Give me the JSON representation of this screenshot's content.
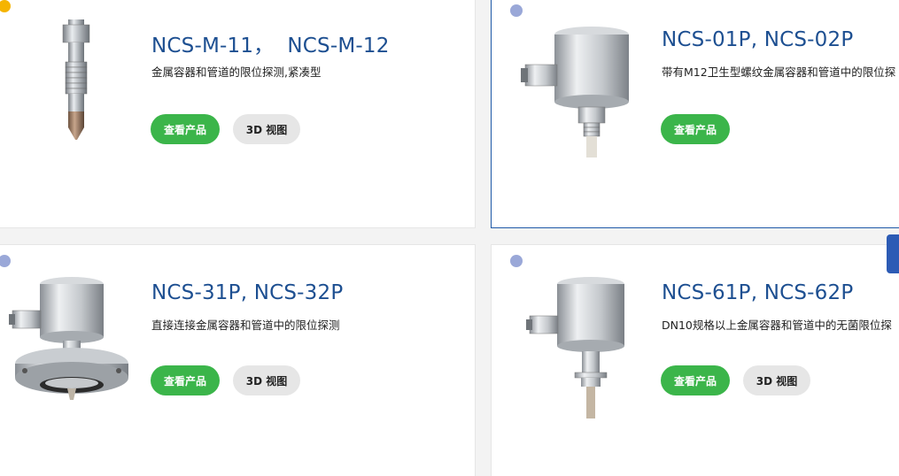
{
  "colors": {
    "title": "#1d4f91",
    "view_button": "#3bb54a",
    "btn_3d": "#e6e6e6",
    "dot_yellow": "#f5b400",
    "dot_blue": "#9aa8d8",
    "active_border": "#1f5aa8",
    "side_tab": "#2c5bb5"
  },
  "products": [
    {
      "title": "NCS-M-11，  NCS-M-12",
      "description": "金属容器和管道的限位探测,紧凑型",
      "view_label": "查看产品",
      "model_label": "3D 视图",
      "dot_color": "yellow",
      "image": "compact-threaded-sensor"
    },
    {
      "title": "NCS-01P, NCS-02P",
      "description": "带有M12卫生型螺纹金属容器和管道中的限位探",
      "view_label": "查看产品",
      "model_label": "",
      "dot_color": "blue",
      "image": "housing-sensor-threaded"
    },
    {
      "title": "NCS-31P, NCS-32P",
      "description": "直接连接金属容器和管道中的限位探测",
      "view_label": "查看产品",
      "model_label": "3D 视图",
      "dot_color": "blue",
      "image": "flange-sensor"
    },
    {
      "title": "NCS-61P, NCS-62P",
      "description": "DN10规格以上金属容器和管道中的无菌限位探",
      "view_label": "查看产品",
      "model_label": "3D 视图",
      "dot_color": "blue",
      "image": "aseptic-sensor"
    }
  ]
}
